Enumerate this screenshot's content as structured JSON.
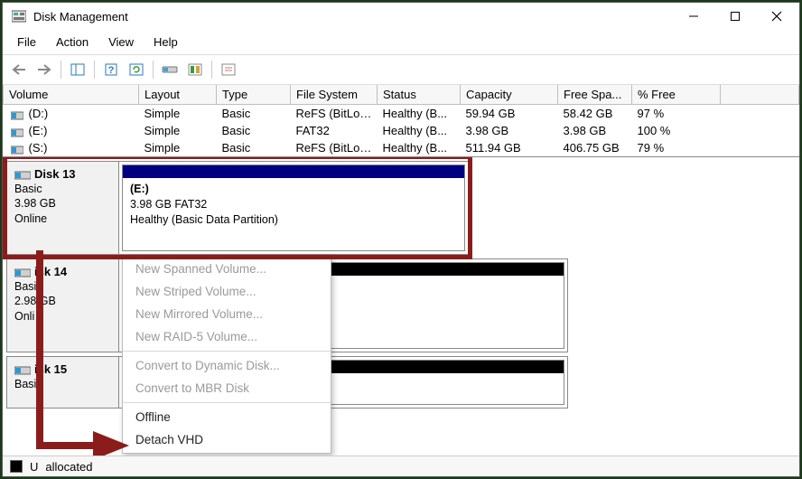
{
  "window": {
    "title": "Disk Management"
  },
  "menu": {
    "file": "File",
    "action": "Action",
    "view": "View",
    "help": "Help"
  },
  "columns": {
    "volume": "Volume",
    "layout": "Layout",
    "type": "Type",
    "fs": "File System",
    "status": "Status",
    "capacity": "Capacity",
    "freespace": "Free Spa...",
    "pctfree": "% Free"
  },
  "volumes": [
    {
      "name": "(D:)",
      "layout": "Simple",
      "type": "Basic",
      "fs": "ReFS (BitLoc...",
      "status": "Healthy (B...",
      "capacity": "59.94 GB",
      "freespace": "58.42 GB",
      "pctfree": "97 %"
    },
    {
      "name": "(E:)",
      "layout": "Simple",
      "type": "Basic",
      "fs": "FAT32",
      "status": "Healthy (B...",
      "capacity": "3.98 GB",
      "freespace": "3.98 GB",
      "pctfree": "100 %"
    },
    {
      "name": "(S:)",
      "layout": "Simple",
      "type": "Basic",
      "fs": "ReFS (BitLoc...",
      "status": "Healthy (B...",
      "capacity": "511.94 GB",
      "freespace": "406.75 GB",
      "pctfree": "79 %"
    }
  ],
  "disks": {
    "d13": {
      "name": "Disk 13",
      "type": "Basic",
      "size": "3.98 GB",
      "state": "Online",
      "part": {
        "name": "(E:)",
        "desc": "3.98 GB FAT32",
        "status": "Healthy (Basic Data Partition)"
      }
    },
    "d14": {
      "name": "isk 14",
      "type_partial": "Basi",
      "size": "2.98 GB",
      "state_partial": "Onli"
    },
    "d15": {
      "name": "isk 15",
      "type_partial": "Basi"
    }
  },
  "context_menu": {
    "new_spanned": "New Spanned Volume...",
    "new_striped": "New Striped Volume...",
    "new_mirrored": "New Mirrored Volume...",
    "new_raid5": "New RAID-5 Volume...",
    "convert_dyn": "Convert to Dynamic Disk...",
    "convert_mbr": "Convert to MBR Disk",
    "offline": "Offline",
    "detach_vhd": "Detach VHD"
  },
  "statusbar": {
    "unallocated": "allocated"
  }
}
